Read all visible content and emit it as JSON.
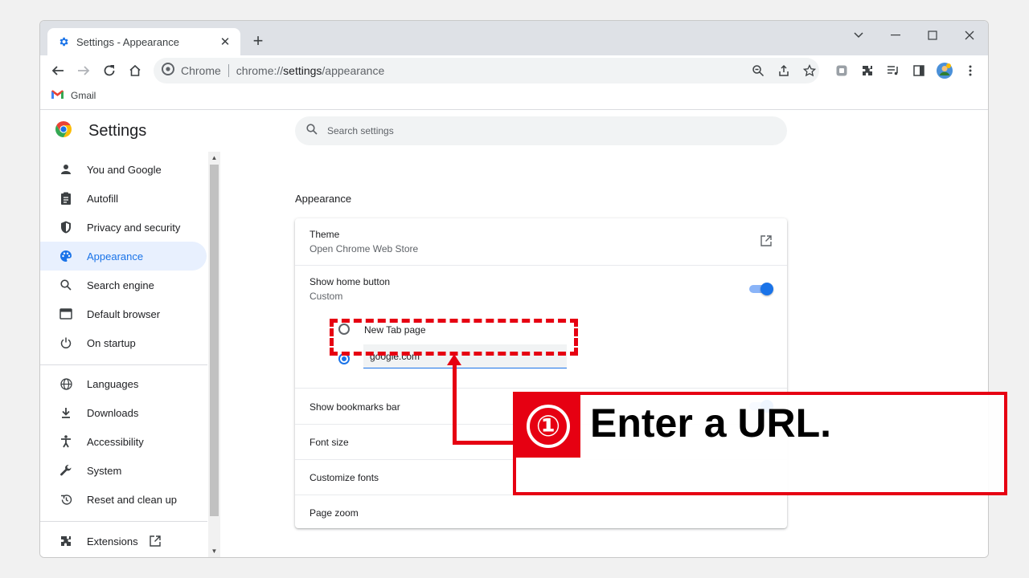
{
  "tab": {
    "title": "Settings - Appearance",
    "close_glyph": "✕",
    "new_tab_glyph": "+"
  },
  "omnibox": {
    "chip": "Chrome",
    "url_prefix": "chrome://",
    "url_host": "settings",
    "url_path": "/appearance"
  },
  "bookmarks": [
    {
      "label": "Gmail"
    }
  ],
  "settings": {
    "title": "Settings",
    "search_placeholder": "Search settings"
  },
  "sidebar": {
    "items": [
      {
        "label": "You and Google",
        "icon": "person-icon"
      },
      {
        "label": "Autofill",
        "icon": "clipboard-icon"
      },
      {
        "label": "Privacy and security",
        "icon": "shield-icon"
      },
      {
        "label": "Appearance",
        "icon": "palette-icon",
        "active": true
      },
      {
        "label": "Search engine",
        "icon": "search-icon"
      },
      {
        "label": "Default browser",
        "icon": "browser-icon"
      },
      {
        "label": "On startup",
        "icon": "power-icon"
      },
      {
        "label": "Languages",
        "icon": "globe-icon"
      },
      {
        "label": "Downloads",
        "icon": "download-icon"
      },
      {
        "label": "Accessibility",
        "icon": "accessibility-icon"
      },
      {
        "label": "System",
        "icon": "wrench-icon"
      },
      {
        "label": "Reset and clean up",
        "icon": "history-icon"
      },
      {
        "label": "Extensions",
        "icon": "puzzle-icon"
      }
    ]
  },
  "appearance": {
    "section_title": "Appearance",
    "theme": {
      "label": "Theme",
      "sub": "Open Chrome Web Store"
    },
    "home_button": {
      "label": "Show home button",
      "sub": "Custom",
      "enabled": true
    },
    "home_options": {
      "new_tab": "New Tab page",
      "custom_url": "google.com",
      "selected": "custom"
    },
    "bookmarks_bar": {
      "label": "Show bookmarks bar",
      "enabled": true
    },
    "font_size": {
      "label": "Font size"
    },
    "customize_fonts": {
      "label": "Customize fonts"
    },
    "page_zoom": {
      "label": "Page zoom"
    }
  },
  "annotation": {
    "number": "①",
    "text": "Enter a URL."
  },
  "colors": {
    "accent": "#1a73e8",
    "annotation_red": "#e60012"
  }
}
